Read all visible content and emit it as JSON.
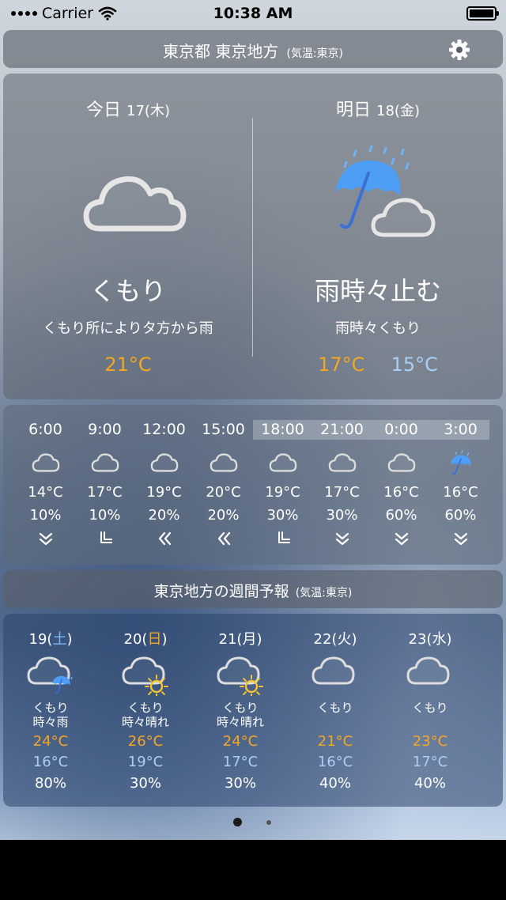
{
  "status_bar": {
    "carrier": "Carrier",
    "time": "10:38 AM"
  },
  "header": {
    "title": "東京都 東京地方",
    "sub": "(気温:東京)"
  },
  "today": {
    "label": "今日",
    "date": "17(木)",
    "condition": "くもり",
    "detail": "くもり所によりタ方から雨",
    "high": "21°C",
    "icon": "cloud-icon"
  },
  "tomorrow": {
    "label": "明日",
    "date": "18(金)",
    "condition": "雨時々止む",
    "detail": "雨時々くもり",
    "high": "17°C",
    "low": "15°C",
    "icon": "umbrella-rain-cloud-icon"
  },
  "hourly": [
    {
      "hour": "6:00",
      "temp": "14°C",
      "pop": "10%",
      "icon": "cloud-icon",
      "wind": "double-chevron-down-icon"
    },
    {
      "hour": "9:00",
      "temp": "17°C",
      "pop": "10%",
      "icon": "cloud-icon",
      "wind": "corner-arrow-icon"
    },
    {
      "hour": "12:00",
      "temp": "19°C",
      "pop": "20%",
      "icon": "cloud-icon",
      "wind": "double-chevron-left-icon"
    },
    {
      "hour": "15:00",
      "temp": "20°C",
      "pop": "20%",
      "icon": "cloud-icon",
      "wind": "double-chevron-left-icon"
    },
    {
      "hour": "18:00",
      "temp": "19°C",
      "pop": "30%",
      "icon": "cloud-icon",
      "wind": "corner-arrow-icon"
    },
    {
      "hour": "21:00",
      "temp": "17°C",
      "pop": "30%",
      "icon": "cloud-icon",
      "wind": "double-chevron-down-icon"
    },
    {
      "hour": "0:00",
      "temp": "16°C",
      "pop": "60%",
      "icon": "cloud-icon",
      "wind": "double-chevron-down-icon"
    },
    {
      "hour": "3:00",
      "temp": "16°C",
      "pop": "60%",
      "icon": "umbrella-icon",
      "wind": "double-chevron-down-icon"
    }
  ],
  "weekly_header": {
    "title": "東京地方の週間予報",
    "sub": "(気温:東京)"
  },
  "weekly": [
    {
      "day_num": "19(",
      "day_name": "土",
      "day_close": ")",
      "day_type": "sat",
      "cond1": "くもり",
      "cond2": "時々雨",
      "high": "24°C",
      "low": "16°C",
      "pop": "80%",
      "icon": "cloud-umbrella-icon"
    },
    {
      "day_num": "20(",
      "day_name": "日",
      "day_close": ")",
      "day_type": "sun",
      "cond1": "くもり",
      "cond2": "時々晴れ",
      "high": "26°C",
      "low": "19°C",
      "pop": "30%",
      "icon": "cloud-sun-icon"
    },
    {
      "day_num": "21(",
      "day_name": "月",
      "day_close": ")",
      "day_type": "",
      "cond1": "くもり",
      "cond2": "時々晴れ",
      "high": "24°C",
      "low": "17°C",
      "pop": "30%",
      "icon": "cloud-sun-icon"
    },
    {
      "day_num": "22(",
      "day_name": "火",
      "day_close": ")",
      "day_type": "",
      "cond1": "くもり",
      "cond2": "",
      "high": "21°C",
      "low": "16°C",
      "pop": "40%",
      "icon": "cloud-icon"
    },
    {
      "day_num": "23(",
      "day_name": "水",
      "day_close": ")",
      "day_type": "",
      "cond1": "くもり",
      "cond2": "",
      "high": "23°C",
      "low": "17°C",
      "pop": "40%",
      "icon": "cloud-icon"
    }
  ],
  "pagination": {
    "pages": 2,
    "current": 1
  }
}
